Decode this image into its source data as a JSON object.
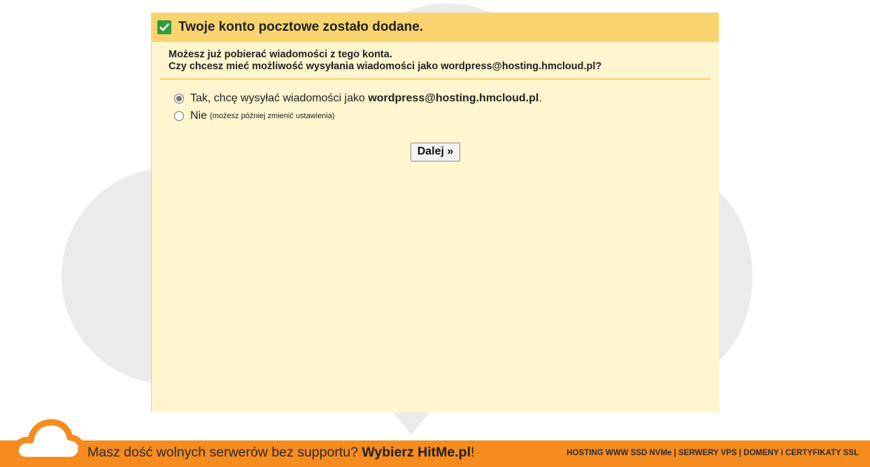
{
  "dialog": {
    "title": "Twoje konto pocztowe zostało dodane.",
    "intro_line1": "Możesz już pobierać wiadomości z tego konta.",
    "intro_line2": "Czy chcesz mieć możliwość wysyłania wiadomości jako wordpress@hosting.hmcloud.pl?",
    "options": [
      {
        "label_prefix": "Tak, chcę wysyłać wiadomości jako ",
        "label_bold": "wordpress@hosting.hmcloud.pl",
        "label_suffix": ".",
        "checked": true
      },
      {
        "label": "Nie",
        "note": "(możesz później zmienić ustawienia)",
        "checked": false
      }
    ],
    "next_button": "Dalej »"
  },
  "banner": {
    "text_prefix": "Masz dość wolnych serwerów bez supportu? ",
    "text_bold": "Wybierz HitMe.pl",
    "text_suffix": "!",
    "right_text": "HOSTING WWW SSD NVMe | SERWERY VPS | DOMENY i CERTYFIKATY SSL"
  },
  "colors": {
    "header_bg": "#f9d46e",
    "panel_bg": "#fff5ce",
    "check_green": "#2e9d3c",
    "banner_orange": "#f68b1f"
  },
  "icons": {
    "check": "check-icon",
    "banner_logo": "cloud-logo-icon"
  }
}
